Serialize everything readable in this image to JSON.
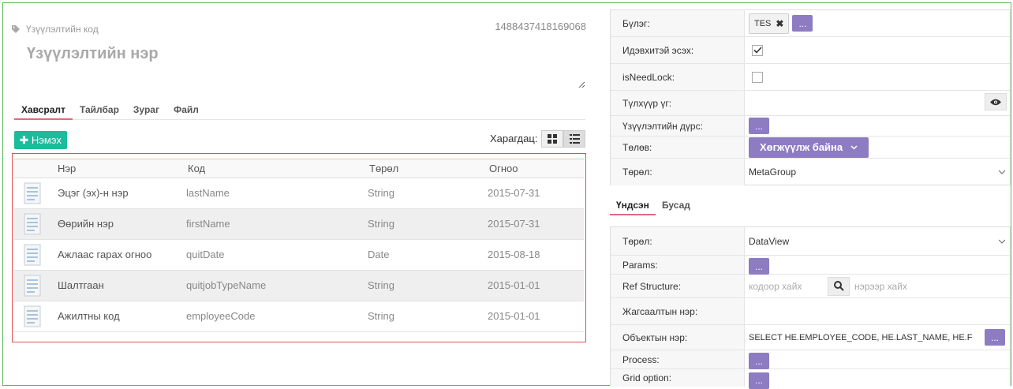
{
  "header": {
    "code_label": "Үзүүлэлтийн код",
    "code_value": "1488437418169068",
    "name_placeholder": "Үзүүлэлтийн нэр"
  },
  "left_tabs": [
    "Хавсралт",
    "Тайлбар",
    "Зураг",
    "Файл"
  ],
  "toolbar": {
    "add_label": "Нэмэх",
    "view_label": "Харагдац:"
  },
  "grid": {
    "columns": [
      "Нэр",
      "Код",
      "Төрөл",
      "Огноо"
    ],
    "rows": [
      {
        "name": "Эцэг (эх)-н нэр",
        "code": "lastName",
        "type": "String",
        "date": "2015-07-31"
      },
      {
        "name": "Өөрийн нэр",
        "code": "firstName",
        "type": "String",
        "date": "2015-07-31"
      },
      {
        "name": "Ажлаас гарах огноо",
        "code": "quitDate",
        "type": "Date",
        "date": "2015-08-18"
      },
      {
        "name": "Шалтгаан",
        "code": "quitjobTypeName",
        "type": "String",
        "date": "2015-01-01"
      },
      {
        "name": "Ажилтны код",
        "code": "employeeCode",
        "type": "String",
        "date": "2015-01-01"
      }
    ]
  },
  "props": {
    "group_label": "Бүлэг:",
    "group_chip": "TES",
    "dots": "...",
    "active_label": "Идэвхитэй эсэх:",
    "active_checked": true,
    "needlock_label": "isNeedLock:",
    "needlock_checked": false,
    "keyword_label": "Түлхүүр үг:",
    "image_label": "Үзүүлэлтийн дүрс:",
    "status_label": "Төлөв:",
    "status_value": "Хөгжүүлж байна",
    "type_label": "Төрөл:",
    "type_value": "MetaGroup"
  },
  "right_tabs": [
    "Үндсэн",
    "Бусад"
  ],
  "main": {
    "type_label": "Төрөл:",
    "type_value": "DataView",
    "params_label": "Params:",
    "ref_label": "Ref Structure:",
    "ref_code_placeholder": "кодоор хайх",
    "ref_name_placeholder": "нэрээр хайх",
    "list_name_label": "Жагсаалтын нэр:",
    "object_name_label": "Объектын нэр:",
    "object_name_value": "SELECT HE.EMPLOYEE_CODE, HE.LAST_NAME, HE.F",
    "process_label": "Process:",
    "grid_option_label": "Grid option:"
  },
  "colors": {
    "accent_green": "#1abc9c",
    "accent_purple": "#8e7cc3",
    "tab_underline": "#e06b7d",
    "grid_border": "#d9534f"
  }
}
